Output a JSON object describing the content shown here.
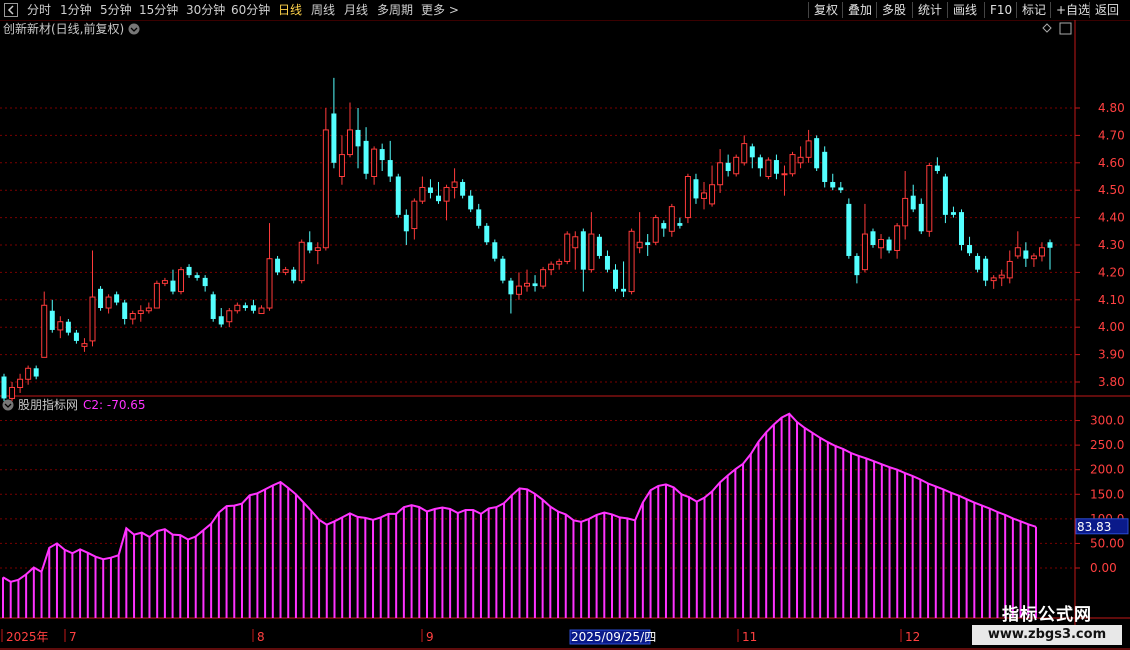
{
  "toolbar": {
    "periods": [
      "分时",
      "1分钟",
      "5分钟",
      "15分钟",
      "30分钟",
      "60分钟",
      "日线",
      "周线",
      "月线",
      "多周期",
      "更多 >"
    ],
    "active_period": "日线",
    "actions": [
      "复权",
      "叠加",
      "多股",
      "统计",
      "画线",
      "F10",
      "标记",
      "+自选",
      "返回"
    ]
  },
  "main_panel": {
    "title": "创新新材(日线,前复权)",
    "price_ticks": [
      "4.80",
      "4.70",
      "4.60",
      "4.50",
      "4.40",
      "4.30",
      "4.20",
      "4.10",
      "4.00",
      "3.90",
      "3.80"
    ]
  },
  "indicator_panel": {
    "name": "股朋指标网",
    "value_label": "C2: -70.65",
    "ticks": [
      "300.0",
      "250.0",
      "200.0",
      "150.0",
      "100.0",
      "50.00",
      "0.00"
    ],
    "current_value": "83.83"
  },
  "time_axis": {
    "labels": [
      "2025年",
      "7",
      "8",
      "9",
      "2025/09/25/四",
      "11",
      "12"
    ]
  },
  "watermark": {
    "line1": "指标公式网",
    "line2": "www.zbgs3.com"
  },
  "colors": {
    "up": "#ff3b3b",
    "down": "#54ffff",
    "indicator": "#ff33ff",
    "grid": "#7a0000",
    "axis": "#c01818",
    "label_up": "#ff4040"
  },
  "chart_data": {
    "type": "candlestick",
    "price_ylim": [
      3.7,
      4.92
    ],
    "indicator_ylim": [
      -70.65,
      320
    ],
    "candles": [
      {
        "o": 3.82,
        "h": 3.83,
        "l": 3.73,
        "c": 3.74
      },
      {
        "o": 3.74,
        "h": 3.8,
        "l": 3.73,
        "c": 3.78
      },
      {
        "o": 3.78,
        "h": 3.83,
        "l": 3.76,
        "c": 3.81
      },
      {
        "o": 3.81,
        "h": 3.86,
        "l": 3.79,
        "c": 3.85
      },
      {
        "o": 3.85,
        "h": 3.86,
        "l": 3.81,
        "c": 3.82
      },
      {
        "o": 3.89,
        "h": 4.13,
        "l": 3.89,
        "c": 4.08
      },
      {
        "o": 4.06,
        "h": 4.1,
        "l": 3.98,
        "c": 3.99
      },
      {
        "o": 3.99,
        "h": 4.04,
        "l": 3.96,
        "c": 4.02
      },
      {
        "o": 4.02,
        "h": 4.03,
        "l": 3.97,
        "c": 3.98
      },
      {
        "o": 3.98,
        "h": 3.99,
        "l": 3.94,
        "c": 3.95
      },
      {
        "o": 3.93,
        "h": 3.96,
        "l": 3.91,
        "c": 3.94
      },
      {
        "o": 3.95,
        "h": 4.28,
        "l": 3.93,
        "c": 4.11
      },
      {
        "o": 4.14,
        "h": 4.15,
        "l": 4.06,
        "c": 4.07
      },
      {
        "o": 4.07,
        "h": 4.12,
        "l": 4.05,
        "c": 4.11
      },
      {
        "o": 4.12,
        "h": 4.13,
        "l": 4.08,
        "c": 4.09
      },
      {
        "o": 4.09,
        "h": 4.1,
        "l": 4.01,
        "c": 4.03
      },
      {
        "o": 4.03,
        "h": 4.06,
        "l": 4.01,
        "c": 4.05
      },
      {
        "o": 4.05,
        "h": 4.08,
        "l": 4.02,
        "c": 4.06
      },
      {
        "o": 4.06,
        "h": 4.09,
        "l": 4.05,
        "c": 4.07
      },
      {
        "o": 4.07,
        "h": 4.17,
        "l": 4.07,
        "c": 4.16
      },
      {
        "o": 4.16,
        "h": 4.18,
        "l": 4.15,
        "c": 4.17
      },
      {
        "o": 4.17,
        "h": 4.21,
        "l": 4.12,
        "c": 4.13
      },
      {
        "o": 4.13,
        "h": 4.22,
        "l": 4.12,
        "c": 4.21
      },
      {
        "o": 4.22,
        "h": 4.23,
        "l": 4.18,
        "c": 4.19
      },
      {
        "o": 4.19,
        "h": 4.2,
        "l": 4.17,
        "c": 4.18
      },
      {
        "o": 4.18,
        "h": 4.19,
        "l": 4.13,
        "c": 4.15
      },
      {
        "o": 4.12,
        "h": 4.13,
        "l": 4.02,
        "c": 4.03
      },
      {
        "o": 4.04,
        "h": 4.07,
        "l": 4.0,
        "c": 4.01
      },
      {
        "o": 4.02,
        "h": 4.07,
        "l": 4.0,
        "c": 4.06
      },
      {
        "o": 4.06,
        "h": 4.09,
        "l": 4.05,
        "c": 4.08
      },
      {
        "o": 4.08,
        "h": 4.09,
        "l": 4.06,
        "c": 4.07
      },
      {
        "o": 4.08,
        "h": 4.1,
        "l": 4.05,
        "c": 4.06
      },
      {
        "o": 4.05,
        "h": 4.08,
        "l": 4.05,
        "c": 4.07
      },
      {
        "o": 4.07,
        "h": 4.38,
        "l": 4.06,
        "c": 4.25
      },
      {
        "o": 4.25,
        "h": 4.26,
        "l": 4.19,
        "c": 4.2
      },
      {
        "o": 4.2,
        "h": 4.22,
        "l": 4.19,
        "c": 4.21
      },
      {
        "o": 4.21,
        "h": 4.22,
        "l": 4.16,
        "c": 4.17
      },
      {
        "o": 4.17,
        "h": 4.32,
        "l": 4.16,
        "c": 4.31
      },
      {
        "o": 4.31,
        "h": 4.35,
        "l": 4.27,
        "c": 4.28
      },
      {
        "o": 4.28,
        "h": 4.31,
        "l": 4.23,
        "c": 4.29
      },
      {
        "o": 4.29,
        "h": 4.8,
        "l": 4.28,
        "c": 4.72
      },
      {
        "o": 4.78,
        "h": 4.91,
        "l": 4.58,
        "c": 4.6
      },
      {
        "o": 4.55,
        "h": 4.7,
        "l": 4.52,
        "c": 4.63
      },
      {
        "o": 4.63,
        "h": 4.82,
        "l": 4.62,
        "c": 4.72
      },
      {
        "o": 4.72,
        "h": 4.8,
        "l": 4.58,
        "c": 4.66
      },
      {
        "o": 4.68,
        "h": 4.73,
        "l": 4.54,
        "c": 4.56
      },
      {
        "o": 4.55,
        "h": 4.66,
        "l": 4.52,
        "c": 4.65
      },
      {
        "o": 4.65,
        "h": 4.67,
        "l": 4.57,
        "c": 4.61
      },
      {
        "o": 4.61,
        "h": 4.68,
        "l": 4.53,
        "c": 4.55
      },
      {
        "o": 4.55,
        "h": 4.56,
        "l": 4.4,
        "c": 4.41
      },
      {
        "o": 4.41,
        "h": 4.43,
        "l": 4.3,
        "c": 4.35
      },
      {
        "o": 4.36,
        "h": 4.47,
        "l": 4.32,
        "c": 4.46
      },
      {
        "o": 4.46,
        "h": 4.55,
        "l": 4.45,
        "c": 4.51
      },
      {
        "o": 4.51,
        "h": 4.54,
        "l": 4.47,
        "c": 4.49
      },
      {
        "o": 4.48,
        "h": 4.53,
        "l": 4.45,
        "c": 4.46
      },
      {
        "o": 4.46,
        "h": 4.52,
        "l": 4.39,
        "c": 4.51
      },
      {
        "o": 4.51,
        "h": 4.58,
        "l": 4.47,
        "c": 4.53
      },
      {
        "o": 4.53,
        "h": 4.54,
        "l": 4.47,
        "c": 4.48
      },
      {
        "o": 4.48,
        "h": 4.5,
        "l": 4.42,
        "c": 4.43
      },
      {
        "o": 4.43,
        "h": 4.45,
        "l": 4.36,
        "c": 4.37
      },
      {
        "o": 4.37,
        "h": 4.38,
        "l": 4.3,
        "c": 4.31
      },
      {
        "o": 4.31,
        "h": 4.32,
        "l": 4.24,
        "c": 4.25
      },
      {
        "o": 4.25,
        "h": 4.26,
        "l": 4.16,
        "c": 4.17
      },
      {
        "o": 4.17,
        "h": 4.18,
        "l": 4.05,
        "c": 4.12
      },
      {
        "o": 4.12,
        "h": 4.2,
        "l": 4.1,
        "c": 4.15
      },
      {
        "o": 4.15,
        "h": 4.21,
        "l": 4.13,
        "c": 4.16
      },
      {
        "o": 4.16,
        "h": 4.19,
        "l": 4.13,
        "c": 4.15
      },
      {
        "o": 4.15,
        "h": 4.22,
        "l": 4.14,
        "c": 4.21
      },
      {
        "o": 4.21,
        "h": 4.24,
        "l": 4.19,
        "c": 4.23
      },
      {
        "o": 4.23,
        "h": 4.25,
        "l": 4.21,
        "c": 4.24
      },
      {
        "o": 4.24,
        "h": 4.35,
        "l": 4.23,
        "c": 4.34
      },
      {
        "o": 4.29,
        "h": 4.35,
        "l": 4.21,
        "c": 4.33
      },
      {
        "o": 4.35,
        "h": 4.36,
        "l": 4.13,
        "c": 4.21
      },
      {
        "o": 4.21,
        "h": 4.42,
        "l": 4.2,
        "c": 4.34
      },
      {
        "o": 4.33,
        "h": 4.34,
        "l": 4.25,
        "c": 4.26
      },
      {
        "o": 4.26,
        "h": 4.28,
        "l": 4.2,
        "c": 4.21
      },
      {
        "o": 4.21,
        "h": 4.23,
        "l": 4.13,
        "c": 4.14
      },
      {
        "o": 4.14,
        "h": 4.24,
        "l": 4.11,
        "c": 4.13
      },
      {
        "o": 4.13,
        "h": 4.36,
        "l": 4.12,
        "c": 4.35
      },
      {
        "o": 4.29,
        "h": 4.42,
        "l": 4.27,
        "c": 4.31
      },
      {
        "o": 4.31,
        "h": 4.34,
        "l": 4.26,
        "c": 4.3
      },
      {
        "o": 4.31,
        "h": 4.41,
        "l": 4.3,
        "c": 4.4
      },
      {
        "o": 4.38,
        "h": 4.39,
        "l": 4.33,
        "c": 4.36
      },
      {
        "o": 4.35,
        "h": 4.45,
        "l": 4.33,
        "c": 4.44
      },
      {
        "o": 4.38,
        "h": 4.4,
        "l": 4.36,
        "c": 4.37
      },
      {
        "o": 4.4,
        "h": 4.56,
        "l": 4.38,
        "c": 4.55
      },
      {
        "o": 4.54,
        "h": 4.56,
        "l": 4.45,
        "c": 4.47
      },
      {
        "o": 4.47,
        "h": 4.53,
        "l": 4.43,
        "c": 4.49
      },
      {
        "o": 4.45,
        "h": 4.59,
        "l": 4.44,
        "c": 4.52
      },
      {
        "o": 4.52,
        "h": 4.65,
        "l": 4.49,
        "c": 4.6
      },
      {
        "o": 4.6,
        "h": 4.63,
        "l": 4.55,
        "c": 4.57
      },
      {
        "o": 4.56,
        "h": 4.63,
        "l": 4.55,
        "c": 4.62
      },
      {
        "o": 4.6,
        "h": 4.7,
        "l": 4.59,
        "c": 4.67
      },
      {
        "o": 4.66,
        "h": 4.67,
        "l": 4.58,
        "c": 4.62
      },
      {
        "o": 4.62,
        "h": 4.63,
        "l": 4.55,
        "c": 4.58
      },
      {
        "o": 4.55,
        "h": 4.62,
        "l": 4.54,
        "c": 4.61
      },
      {
        "o": 4.61,
        "h": 4.63,
        "l": 4.54,
        "c": 4.56
      },
      {
        "o": 4.56,
        "h": 4.59,
        "l": 4.48,
        "c": 4.56
      },
      {
        "o": 4.56,
        "h": 4.64,
        "l": 4.55,
        "c": 4.63
      },
      {
        "o": 4.6,
        "h": 4.66,
        "l": 4.58,
        "c": 4.62
      },
      {
        "o": 4.62,
        "h": 4.72,
        "l": 4.6,
        "c": 4.68
      },
      {
        "o": 4.69,
        "h": 4.7,
        "l": 4.57,
        "c": 4.58
      },
      {
        "o": 4.64,
        "h": 4.66,
        "l": 4.51,
        "c": 4.53
      },
      {
        "o": 4.53,
        "h": 4.56,
        "l": 4.5,
        "c": 4.51
      },
      {
        "o": 4.51,
        "h": 4.53,
        "l": 4.49,
        "c": 4.5
      },
      {
        "o": 4.45,
        "h": 4.47,
        "l": 4.25,
        "c": 4.26
      },
      {
        "o": 4.26,
        "h": 4.27,
        "l": 4.16,
        "c": 4.19
      },
      {
        "o": 4.21,
        "h": 4.45,
        "l": 4.2,
        "c": 4.34
      },
      {
        "o": 4.35,
        "h": 4.36,
        "l": 4.29,
        "c": 4.3
      },
      {
        "o": 4.29,
        "h": 4.34,
        "l": 4.25,
        "c": 4.32
      },
      {
        "o": 4.32,
        "h": 4.33,
        "l": 4.27,
        "c": 4.28
      },
      {
        "o": 4.28,
        "h": 4.38,
        "l": 4.25,
        "c": 4.37
      },
      {
        "o": 4.37,
        "h": 4.57,
        "l": 4.32,
        "c": 4.47
      },
      {
        "o": 4.48,
        "h": 4.52,
        "l": 4.42,
        "c": 4.43
      },
      {
        "o": 4.45,
        "h": 4.47,
        "l": 4.34,
        "c": 4.35
      },
      {
        "o": 4.35,
        "h": 4.6,
        "l": 4.33,
        "c": 4.59
      },
      {
        "o": 4.59,
        "h": 4.62,
        "l": 4.56,
        "c": 4.57
      },
      {
        "o": 4.55,
        "h": 4.56,
        "l": 4.38,
        "c": 4.41
      },
      {
        "o": 4.42,
        "h": 4.44,
        "l": 4.4,
        "c": 4.41
      },
      {
        "o": 4.42,
        "h": 4.43,
        "l": 4.28,
        "c": 4.3
      },
      {
        "o": 4.3,
        "h": 4.33,
        "l": 4.26,
        "c": 4.27
      },
      {
        "o": 4.26,
        "h": 4.27,
        "l": 4.2,
        "c": 4.21
      },
      {
        "o": 4.25,
        "h": 4.26,
        "l": 4.15,
        "c": 4.17
      },
      {
        "o": 4.17,
        "h": 4.19,
        "l": 4.14,
        "c": 4.18
      },
      {
        "o": 4.18,
        "h": 4.21,
        "l": 4.15,
        "c": 4.19
      },
      {
        "o": 4.18,
        "h": 4.28,
        "l": 4.16,
        "c": 4.24
      },
      {
        "o": 4.26,
        "h": 4.35,
        "l": 4.25,
        "c": 4.29
      },
      {
        "o": 4.28,
        "h": 4.31,
        "l": 4.22,
        "c": 4.25
      },
      {
        "o": 4.25,
        "h": 4.27,
        "l": 4.22,
        "c": 4.26
      },
      {
        "o": 4.26,
        "h": 4.31,
        "l": 4.24,
        "c": 4.29
      },
      {
        "o": 4.31,
        "h": 4.32,
        "l": 4.21,
        "c": 4.29
      }
    ],
    "indicator": [
      -19,
      -28,
      -24,
      -13,
      1,
      -8,
      41,
      50,
      37,
      30,
      38,
      31,
      23,
      18,
      21,
      26,
      81,
      68,
      72,
      63,
      75,
      79,
      68,
      67,
      58,
      64,
      77,
      90,
      113,
      126,
      127,
      131,
      148,
      152,
      160,
      168,
      175,
      163,
      150,
      133,
      116,
      98,
      88,
      95,
      103,
      111,
      104,
      102,
      98,
      103,
      110,
      110,
      124,
      128,
      124,
      115,
      120,
      123,
      120,
      112,
      118,
      118,
      110,
      121,
      124,
      132,
      148,
      162,
      160,
      151,
      139,
      125,
      115,
      109,
      97,
      94,
      100,
      108,
      113,
      109,
      103,
      101,
      97,
      133,
      158,
      167,
      170,
      164,
      150,
      144,
      135,
      143,
      156,
      174,
      188,
      201,
      212,
      232,
      257,
      276,
      292,
      306,
      314,
      297,
      285,
      275,
      265,
      256,
      248,
      242,
      234,
      228,
      223,
      217,
      211,
      205,
      200,
      193,
      187,
      180,
      172,
      166,
      160,
      153,
      147,
      140,
      133,
      127,
      121,
      114,
      108,
      101,
      95,
      89,
      83.83
    ]
  }
}
